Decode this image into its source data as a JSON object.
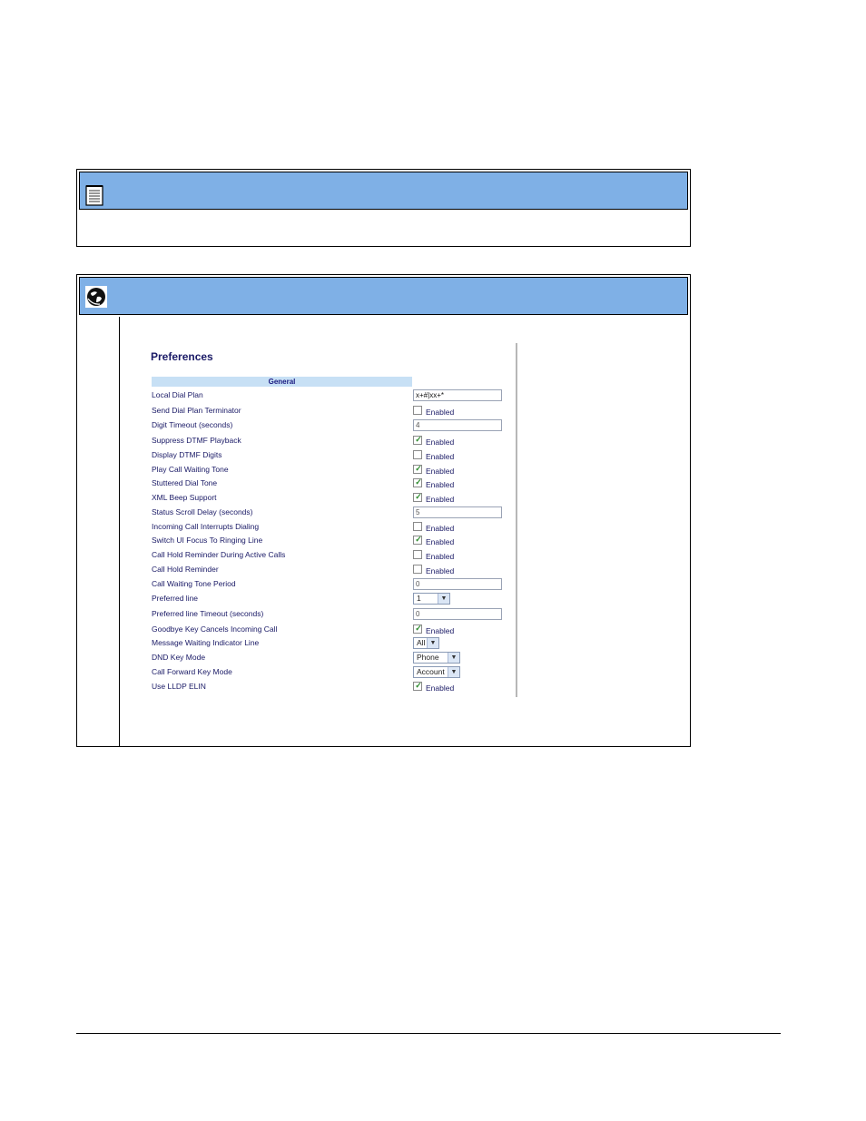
{
  "preferences": {
    "title": "Preferences",
    "section": "General",
    "enabled_label": "Enabled",
    "rows": [
      {
        "label": "Local Dial Plan",
        "type": "text",
        "value": "x+#|xx+*"
      },
      {
        "label": "Send Dial Plan Terminator",
        "type": "checkbox",
        "checked": false
      },
      {
        "label": "Digit Timeout (seconds)",
        "type": "text",
        "value": "4"
      },
      {
        "label": "Suppress DTMF Playback",
        "type": "checkbox",
        "checked": true
      },
      {
        "label": "Display DTMF Digits",
        "type": "checkbox",
        "checked": false
      },
      {
        "label": "Play Call Waiting Tone",
        "type": "checkbox",
        "checked": true
      },
      {
        "label": "Stuttered Dial Tone",
        "type": "checkbox",
        "checked": true
      },
      {
        "label": "XML Beep Support",
        "type": "checkbox",
        "checked": true
      },
      {
        "label": "Status Scroll Delay (seconds)",
        "type": "text",
        "value": "5"
      },
      {
        "label": "Incoming Call Interrupts Dialing",
        "type": "checkbox",
        "checked": false
      },
      {
        "label": "Switch UI Focus To Ringing Line",
        "type": "checkbox",
        "checked": true
      },
      {
        "label": "Call Hold Reminder During Active Calls",
        "type": "checkbox",
        "checked": false
      },
      {
        "label": "Call Hold Reminder",
        "type": "checkbox",
        "checked": false
      },
      {
        "label": "Call Waiting Tone Period",
        "type": "text",
        "value": "0"
      },
      {
        "label": "Preferred line",
        "type": "select",
        "value": "1"
      },
      {
        "label": "Preferred line Timeout (seconds)",
        "type": "text",
        "value": "0"
      },
      {
        "label": "Goodbye Key Cancels Incoming Call",
        "type": "checkbox",
        "checked": true
      },
      {
        "label": "Message Waiting Indicator Line",
        "type": "select",
        "value": "All"
      },
      {
        "label": "DND Key Mode",
        "type": "select",
        "value": "Phone"
      },
      {
        "label": "Call Forward Key Mode",
        "type": "select",
        "value": "Account"
      },
      {
        "label": "Use LLDP ELIN",
        "type": "checkbox",
        "checked": true
      }
    ]
  },
  "icons": {
    "note": "note-icon",
    "web": "globe-icon"
  },
  "colors": {
    "header_blue": "#7fb0e6",
    "section_blue": "#c7e0f5",
    "text_navy": "#1a1a66"
  }
}
